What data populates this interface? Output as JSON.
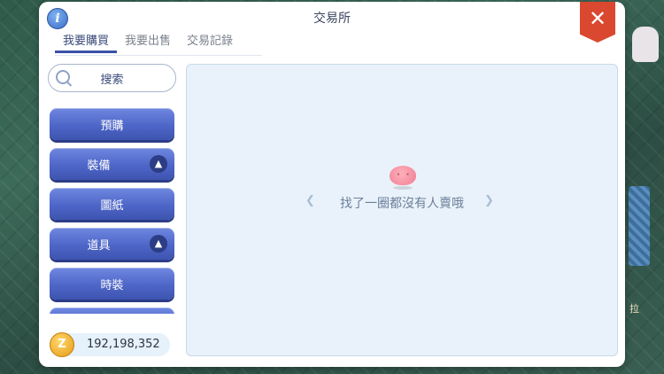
{
  "window": {
    "title": "交易所"
  },
  "tabs": [
    {
      "label": "我要購買",
      "active": true
    },
    {
      "label": "我要出售",
      "active": false
    },
    {
      "label": "交易記錄",
      "active": false
    }
  ],
  "search": {
    "label": "搜索"
  },
  "categories": [
    {
      "label": "預購",
      "expandable": false
    },
    {
      "label": "裝備",
      "expandable": true
    },
    {
      "label": "圖紙",
      "expandable": false
    },
    {
      "label": "道具",
      "expandable": true
    },
    {
      "label": "時裝",
      "expandable": false
    }
  ],
  "currency": {
    "amount": "192,198,352",
    "icon": "zeny-coin-icon",
    "symbol": "Z"
  },
  "empty_state": {
    "message": "找了一圈都沒有人賣哦"
  },
  "background": {
    "side_text": "拉"
  },
  "colors": {
    "accent_blue": "#4e66c8",
    "close_red": "#d9482f",
    "panel_bg": "#e9f2fa"
  }
}
